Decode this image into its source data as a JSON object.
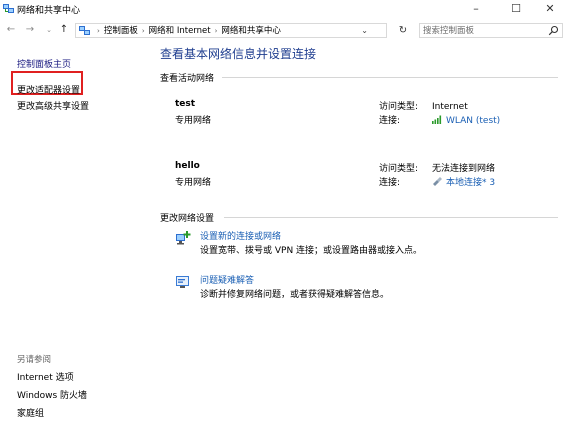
{
  "window": {
    "title": "网络和共享中心",
    "controls": {
      "minimize": "–",
      "maximize": "☐",
      "close": "✕"
    }
  },
  "nav": {
    "back": "←",
    "forward": "→",
    "recent": "⌄",
    "up": "↑",
    "breadcrumbs": [
      "控制面板",
      "网络和 Internet",
      "网络和共享中心"
    ],
    "breadcrumb_sep": "›",
    "dropdown": "⌄",
    "refresh": "↻",
    "search_placeholder": "搜索控制面板"
  },
  "sidebar": {
    "home": "控制面板主页",
    "items": [
      {
        "label": "更改适配器设置"
      },
      {
        "label": "更改高级共享设置"
      }
    ],
    "see_also_title": "另请参阅",
    "see_also": [
      {
        "label": "Internet 选项"
      },
      {
        "label": "Windows 防火墙"
      },
      {
        "label": "家庭组"
      }
    ]
  },
  "main": {
    "title": "查看基本网络信息并设置连接",
    "active_networks_label": "查看活动网络",
    "networks": [
      {
        "name": "test",
        "type": "专用网络",
        "access_key": "访问类型:",
        "access_value": "Internet",
        "conn_key": "连接:",
        "conn_value": "WLAN (test)",
        "conn_icon": "wifi-signal-icon"
      },
      {
        "name": "hello",
        "type": "专用网络",
        "access_key": "访问类型:",
        "access_value": "无法连接到网络",
        "conn_key": "连接:",
        "conn_value": "本地连接* 3",
        "conn_icon": "ethernet-cable-icon"
      }
    ],
    "change_settings_label": "更改网络设置",
    "tasks": [
      {
        "link": "设置新的连接或网络",
        "desc": "设置宽带、拨号或 VPN 连接；或设置路由器或接入点。",
        "icon": "new-connection-icon"
      },
      {
        "link": "问题疑难解答",
        "desc": "诊断并修复网络问题，或者获得疑难解答信息。",
        "icon": "troubleshoot-icon"
      }
    ]
  },
  "colors": {
    "link": "#1a5fb4",
    "title": "#1e3d8f",
    "highlight": "#e02020"
  }
}
